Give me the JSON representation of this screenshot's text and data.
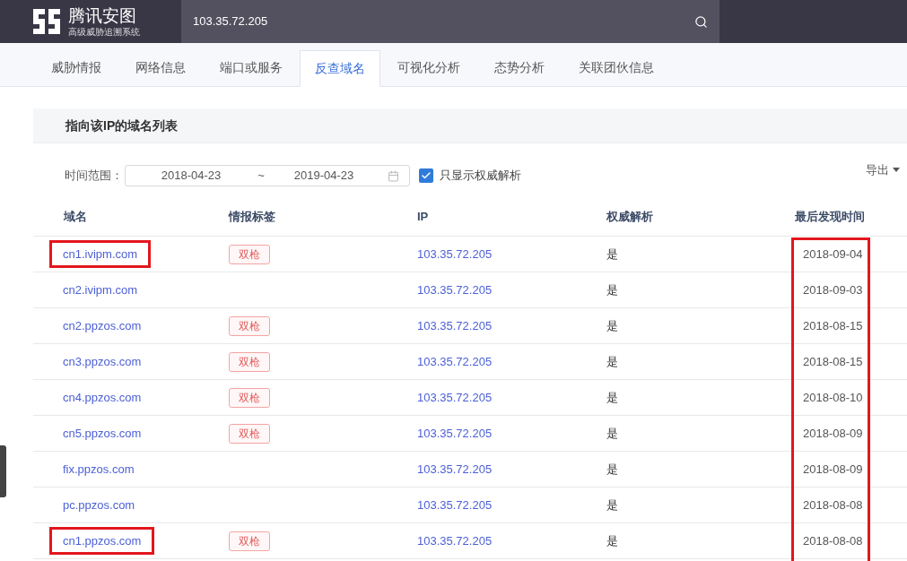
{
  "header": {
    "brand": "腾讯安图",
    "subtitle": "高级威胁追溯系统",
    "search_value": "103.35.72.205"
  },
  "tabs": [
    {
      "label": "威胁情报",
      "selected": false
    },
    {
      "label": "网络信息",
      "selected": false
    },
    {
      "label": "端口或服务",
      "selected": false
    },
    {
      "label": "反查域名",
      "selected": true
    },
    {
      "label": "可视化分析",
      "selected": false
    },
    {
      "label": "态势分析",
      "selected": false
    },
    {
      "label": "关联团伙信息",
      "selected": false
    }
  ],
  "panel": {
    "title": "指向该IP的域名列表"
  },
  "filter": {
    "label": "时间范围：",
    "start": "2018-04-23",
    "separator": "~",
    "end": "2019-04-23",
    "authoritative_only": {
      "label": "只显示权威解析",
      "checked": true
    },
    "export": "导出"
  },
  "table": {
    "columns": [
      "域名",
      "情报标签",
      "IP",
      "权威解析",
      "最后发现时间"
    ],
    "last_seen_highlighted": true,
    "rows": [
      {
        "domain": "cn1.ivipm.com",
        "domain_highlighted": true,
        "tag": "双枪",
        "ip": "103.35.72.205",
        "authoritative": "是",
        "last_seen": "2018-09-04"
      },
      {
        "domain": "cn2.ivipm.com",
        "domain_highlighted": false,
        "ip": "103.35.72.205",
        "authoritative": "是",
        "last_seen": "2018-09-03"
      },
      {
        "domain": "cn2.ppzos.com",
        "domain_highlighted": false,
        "tag": "双枪",
        "ip": "103.35.72.205",
        "authoritative": "是",
        "last_seen": "2018-08-15"
      },
      {
        "domain": "cn3.ppzos.com",
        "domain_highlighted": false,
        "tag": "双枪",
        "ip": "103.35.72.205",
        "authoritative": "是",
        "last_seen": "2018-08-15"
      },
      {
        "domain": "cn4.ppzos.com",
        "domain_highlighted": false,
        "tag": "双枪",
        "ip": "103.35.72.205",
        "authoritative": "是",
        "last_seen": "2018-08-10"
      },
      {
        "domain": "cn5.ppzos.com",
        "domain_highlighted": false,
        "tag": "双枪",
        "ip": "103.35.72.205",
        "authoritative": "是",
        "last_seen": "2018-08-09"
      },
      {
        "domain": "fix.ppzos.com",
        "domain_highlighted": false,
        "ip": "103.35.72.205",
        "authoritative": "是",
        "last_seen": "2018-08-09"
      },
      {
        "domain": "pc.ppzos.com",
        "domain_highlighted": false,
        "ip": "103.35.72.205",
        "authoritative": "是",
        "last_seen": "2018-08-08"
      },
      {
        "domain": "cn1.ppzos.com",
        "domain_highlighted": true,
        "tag": "双枪",
        "ip": "103.35.72.205",
        "authoritative": "是",
        "last_seen": "2018-08-08"
      }
    ]
  }
}
